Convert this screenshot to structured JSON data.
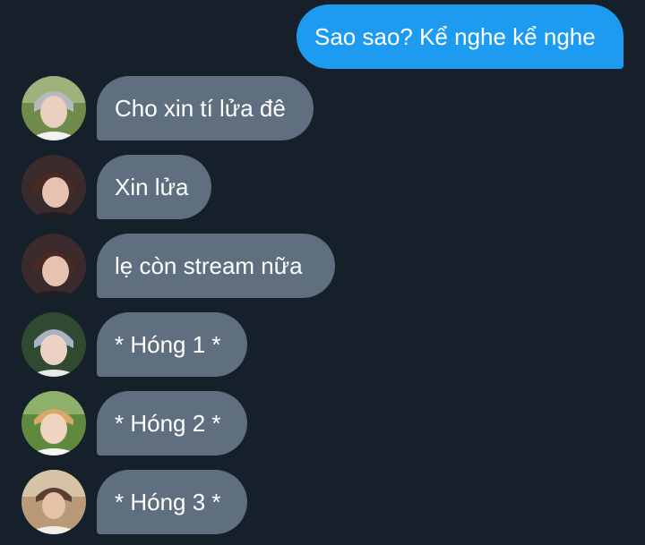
{
  "conversation": {
    "outgoing": [
      {
        "text": "Sao sao? Kể nghe kể nghe"
      }
    ],
    "incoming": [
      {
        "text": "Cho xin tí lửa đê",
        "avatar": "avatar-photo-icon"
      },
      {
        "text": "Xin lửa",
        "avatar": "avatar-photo-icon"
      },
      {
        "text": "lẹ còn stream nữa",
        "avatar": "avatar-photo-icon"
      },
      {
        "text": "* Hóng 1 *",
        "avatar": "avatar-photo-icon"
      },
      {
        "text": "* Hóng 2 *",
        "avatar": "avatar-photo-icon"
      },
      {
        "text": "* Hóng 3 *",
        "avatar": "avatar-photo-icon"
      }
    ]
  },
  "colors": {
    "background": "#15202b",
    "outgoing_bubble": "#1d9bf0",
    "incoming_bubble": "#5f6f80",
    "text": "#ffffff"
  }
}
